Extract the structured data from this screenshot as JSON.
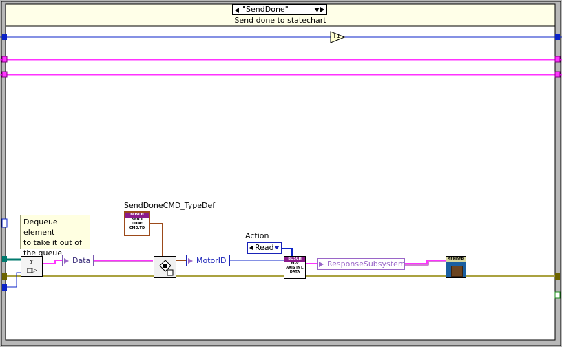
{
  "case_structure": {
    "selector_value": "\"SendDone\"",
    "subdiagram_label": "Send done to statechart"
  },
  "increment_node": {
    "label": "+1"
  },
  "comment": {
    "text": "Dequeue element\nto take it out of\nthe queue"
  },
  "typedef_constant": {
    "label": "SendDoneCMD_TypeDef",
    "icon_brand": "BOSCH",
    "icon_text": "SEND\nDONE\nCMD.TD"
  },
  "dequeue_node": {
    "icon_text": "Σ\n□▷"
  },
  "unbundle": {
    "items": [
      {
        "label": "Data"
      },
      {
        "label": "MotorID"
      }
    ]
  },
  "action_control": {
    "label": "Action",
    "value": "Read"
  },
  "fgv_subvi": {
    "icon_brand": "BOSCH",
    "icon_text": "FGV\nAXIS INT.\nDATA"
  },
  "response_element": {
    "label": "ResponseSubsystem"
  },
  "send_subvi": {
    "icon_brand": "SENDER"
  },
  "colors": {
    "frame_gray": "#b8b8b8",
    "wire_blue": "#0b23c8",
    "wire_pink": "#ff33ff",
    "wire_olive": "#6b6300",
    "wire_teal": "#007a6e",
    "wire_brown": "#9c4a1a",
    "class_purple": "#7a5ab0",
    "enum_blue": "#1a23b8"
  }
}
